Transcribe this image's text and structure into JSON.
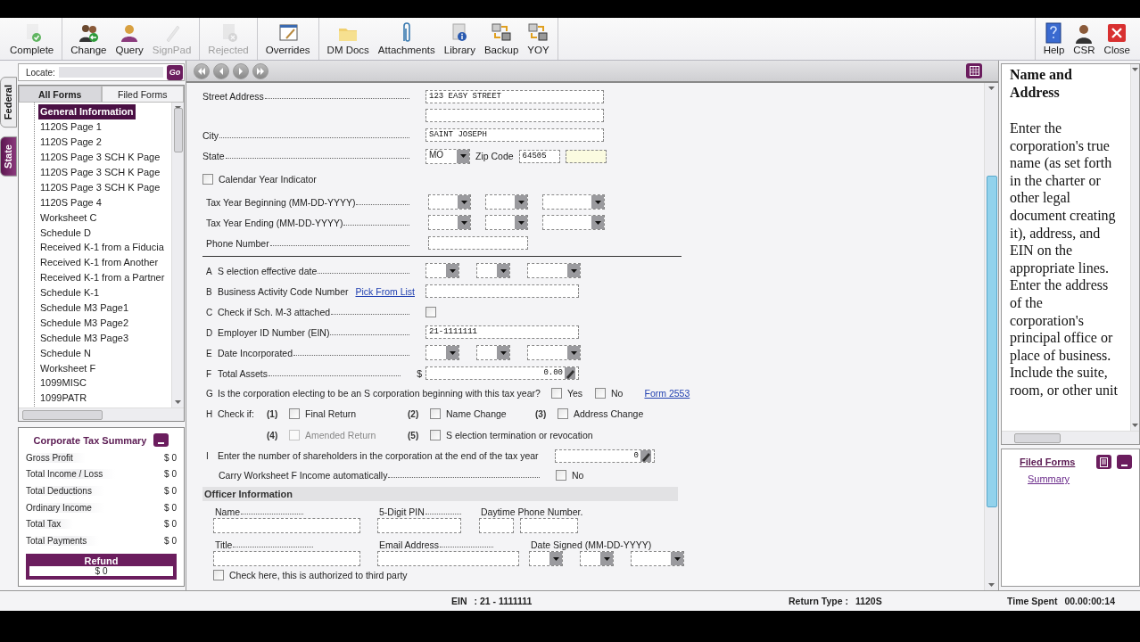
{
  "toolbar": {
    "groups": [
      [
        {
          "label": "Complete",
          "disabled": false
        }
      ],
      [
        {
          "label": "Change",
          "disabled": false
        },
        {
          "label": "Query",
          "disabled": false
        },
        {
          "label": "SignPad",
          "disabled": true
        }
      ],
      [
        {
          "label": "Rejected",
          "disabled": true
        }
      ],
      [
        {
          "label": "Overrides",
          "disabled": false
        }
      ],
      [
        {
          "label": "DM Docs",
          "disabled": false
        },
        {
          "label": "Attachments",
          "disabled": false
        },
        {
          "label": "Library",
          "disabled": false
        },
        {
          "label": "Backup",
          "disabled": false
        },
        {
          "label": "YOY",
          "disabled": false
        }
      ]
    ],
    "right": [
      {
        "label": "Help",
        "disabled": false
      },
      {
        "label": "CSR",
        "disabled": false
      },
      {
        "label": "Close",
        "disabled": false
      }
    ]
  },
  "side_tabs": [
    {
      "label": "Federal",
      "selected": true
    },
    {
      "label": "State",
      "selected": false
    }
  ],
  "locate": {
    "label": "Locate:",
    "button": "Go"
  },
  "forms_tabs": [
    {
      "label": "All Forms",
      "selected": true
    },
    {
      "label": "Filed Forms",
      "selected": false
    }
  ],
  "forms_tree": [
    {
      "label": "General Information",
      "selected": true
    },
    {
      "label": "1120S Page 1",
      "selected": false
    },
    {
      "label": "1120S Page 2",
      "selected": false
    },
    {
      "label": "1120S Page 3 SCH K Page",
      "selected": false
    },
    {
      "label": "1120S Page 3 SCH K Page",
      "selected": false
    },
    {
      "label": "1120S Page 3 SCH K Page",
      "selected": false
    },
    {
      "label": "1120S Page 4",
      "selected": false
    },
    {
      "label": "Worksheet C",
      "selected": false
    },
    {
      "label": "Schedule D",
      "selected": false
    },
    {
      "label": "Received K-1 from a Fiducia",
      "selected": false
    },
    {
      "label": "Received  K-1 from Another",
      "selected": false
    },
    {
      "label": "Received K-1 from a Partner",
      "selected": false
    },
    {
      "label": "Schedule K-1",
      "selected": false
    },
    {
      "label": "Schedule M3 Page1",
      "selected": false
    },
    {
      "label": "Schedule M3 Page2",
      "selected": false
    },
    {
      "label": "Schedule M3 Page3",
      "selected": false
    },
    {
      "label": "Schedule N",
      "selected": false
    },
    {
      "label": "Worksheet F",
      "selected": false
    },
    {
      "label": "1099MISC",
      "selected": false
    },
    {
      "label": "1099PATR",
      "selected": false
    }
  ],
  "summary": {
    "title": "Corporate Tax Summary",
    "rows": [
      {
        "label": "Gross Profit",
        "value": "$ 0"
      },
      {
        "label": "Total Income / Loss",
        "value": "$ 0"
      },
      {
        "label": "Total Deductions",
        "value": "$ 0"
      },
      {
        "label": "Ordinary Income",
        "value": "$ 0"
      },
      {
        "label": "Total Tax",
        "value": "$ 0"
      },
      {
        "label": "Total Payments",
        "value": "$ 0"
      }
    ],
    "refund": {
      "label": "Refund",
      "value": "$ 0"
    }
  },
  "form": {
    "street": {
      "label": "Street Address",
      "value": "123 EASY STREET"
    },
    "city": {
      "label": "City",
      "value": "SAINT JOSEPH"
    },
    "state": {
      "label": "State",
      "value": "MO",
      "zip_label": "Zip Code",
      "zip": "64505"
    },
    "calendar_year": {
      "label": "Calendar Year Indicator",
      "checked": false
    },
    "tax_years": [
      {
        "label": "Tax Year Beginning (MM-DD-YYYY)"
      },
      {
        "label": "Tax Year Ending (MM-DD-YYYY)"
      }
    ],
    "phone": {
      "label": "Phone Number"
    },
    "lines": [
      {
        "letter": "A",
        "label": "S election effective date",
        "kind": "date"
      },
      {
        "letter": "B",
        "label": "Business Activity Code Number",
        "link": "Pick From List",
        "kind": "text"
      },
      {
        "letter": "C",
        "label": "Check if Sch. M-3 attached",
        "kind": "check",
        "checked": false
      },
      {
        "letter": "D",
        "label": "Employer ID Number (EIN)",
        "kind": "text",
        "value": "21-1111111"
      },
      {
        "letter": "E",
        "label": "Date Incorporated",
        "kind": "date"
      },
      {
        "letter": "F",
        "label": "Total Assets",
        "kind": "amount",
        "currency": "$",
        "value": "0.00"
      }
    ],
    "question_g": {
      "letter": "G",
      "label": "Is the corporation electing to be an S corporation beginning with this tax year?",
      "options": [
        {
          "label": "Yes",
          "checked": false
        },
        {
          "label": "No",
          "checked": false
        }
      ],
      "link": "Form 2553"
    },
    "check_h": {
      "letter": "H",
      "label": "Check if:",
      "options": [
        {
          "number": "(1)",
          "label": "Final Return",
          "checked": false,
          "disabled": false
        },
        {
          "number": "(2)",
          "label": "Name Change",
          "checked": false,
          "disabled": false
        },
        {
          "number": "(3)",
          "label": "Address Change",
          "checked": false,
          "disabled": false
        },
        {
          "number": "(4)",
          "label": "Amended Return",
          "checked": false,
          "disabled": true
        },
        {
          "number": "(5)",
          "label": "S election termination or revocation",
          "checked": false,
          "disabled": false
        }
      ]
    },
    "shareholders": {
      "letter": "I",
      "label": "Enter the number of shareholders in the corporation at the end of the tax year",
      "value": "0"
    },
    "carry": {
      "label": "Carry Worksheet F Income automatically",
      "option": {
        "label": "No",
        "checked": false
      }
    },
    "officer": {
      "title": "Officer Information",
      "name": "Name",
      "pin": "5-Digit PIN",
      "phone": "Daytime Phone Number.",
      "job_title": "Title",
      "email": "Email Address",
      "date_signed": "Date Signed (MM-DD-YYYY)",
      "authorize": {
        "label": "Check here, this is authorized to third party",
        "checked": false
      }
    }
  },
  "help": {
    "title": "Name and Address",
    "body": "Enter the corporation's true name (as set forth in the charter or other legal document creating it), address, and EIN on the appropriate lines. Enter the address of the corporation's principal office or place of business. Include the suite, room, or other unit"
  },
  "filed_forms": {
    "title": "Filed Forms",
    "items": [
      {
        "label": "Summary"
      }
    ]
  },
  "status_bar": [
    {
      "label": "EIN",
      "value": ": 21 - 1111111"
    },
    {
      "label": "Return Type :",
      "value": "1120S"
    },
    {
      "label": "Time Spent",
      "value": "00.00:00:14"
    }
  ]
}
